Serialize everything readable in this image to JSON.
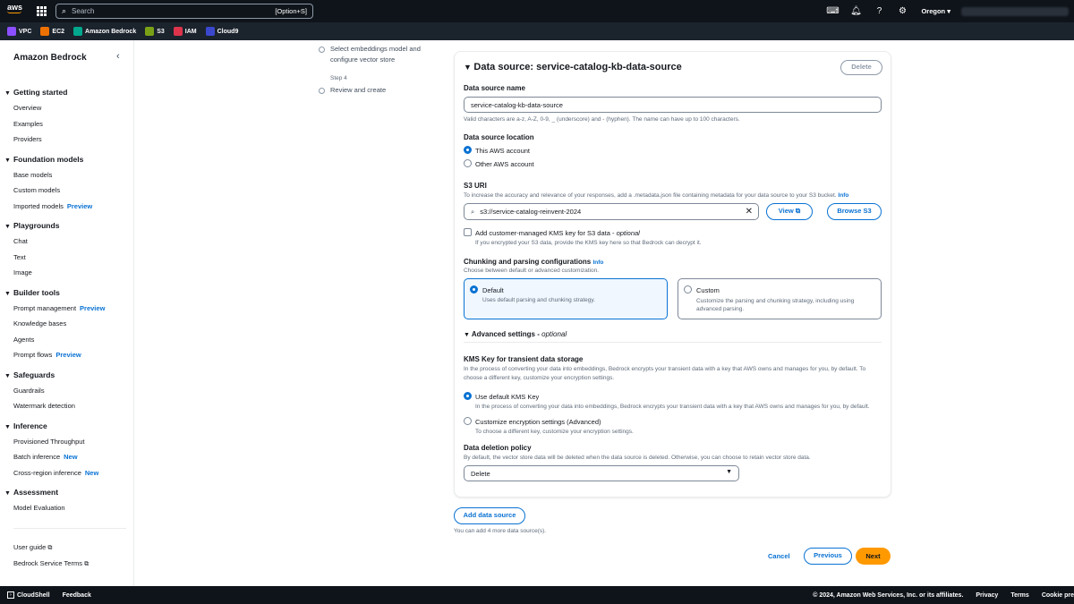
{
  "topbar": {
    "logo_text": "aws",
    "search_placeholder": "Search",
    "search_shortcut": "[Option+S]",
    "region": "Oregon"
  },
  "favorites": [
    {
      "label": "VPC",
      "color": "#8c4fff"
    },
    {
      "label": "EC2",
      "color": "#ed7100"
    },
    {
      "label": "Amazon Bedrock",
      "color": "#01a88d"
    },
    {
      "label": "S3",
      "color": "#7aa116"
    },
    {
      "label": "IAM",
      "color": "#dd344c"
    },
    {
      "label": "Cloud9",
      "color": "#3b48cc"
    }
  ],
  "sidebar": {
    "title": "Amazon Bedrock",
    "sections": [
      {
        "title": "Getting started",
        "items": [
          {
            "label": "Overview"
          },
          {
            "label": "Examples"
          },
          {
            "label": "Providers"
          }
        ]
      },
      {
        "title": "Foundation models",
        "items": [
          {
            "label": "Base models"
          },
          {
            "label": "Custom models"
          },
          {
            "label": "Imported models",
            "badge": "Preview"
          }
        ]
      },
      {
        "title": "Playgrounds",
        "items": [
          {
            "label": "Chat"
          },
          {
            "label": "Text"
          },
          {
            "label": "Image"
          }
        ]
      },
      {
        "title": "Builder tools",
        "items": [
          {
            "label": "Prompt management",
            "badge": "Preview"
          },
          {
            "label": "Knowledge bases"
          },
          {
            "label": "Agents"
          },
          {
            "label": "Prompt flows",
            "badge": "Preview"
          }
        ]
      },
      {
        "title": "Safeguards",
        "items": [
          {
            "label": "Guardrails"
          },
          {
            "label": "Watermark detection"
          }
        ]
      },
      {
        "title": "Inference",
        "items": [
          {
            "label": "Provisioned Throughput"
          },
          {
            "label": "Batch inference",
            "badge": "New"
          },
          {
            "label": "Cross-region inference",
            "badge": "New"
          }
        ]
      },
      {
        "title": "Assessment",
        "items": [
          {
            "label": "Model Evaluation"
          }
        ]
      }
    ],
    "footer_links": [
      {
        "label": "User guide"
      },
      {
        "label": "Bedrock Service Terms"
      }
    ]
  },
  "steps": {
    "step3_label": "Select embeddings model and configure vector store",
    "step4_num": "Step 4",
    "step4_label": "Review and create"
  },
  "panel": {
    "title": "Data source: service-catalog-kb-data-source",
    "delete_label": "Delete",
    "name_label": "Data source name",
    "name_value": "service-catalog-kb-data-source",
    "name_hint": "Valid characters are a-z, A-Z, 0-9, _ (underscore) and - (hyphen). The name can have up to 100 characters.",
    "location_label": "Data source location",
    "loc_this": "This AWS account",
    "loc_other": "Other AWS account",
    "s3_label": "S3 URI",
    "s3_hint": "To increase the accuracy and relevance of your responses, add a .metadata.json file containing metadata for your data source to your S3 bucket.",
    "info": "Info",
    "s3_value": "s3://service-catalog-reinvent-2024",
    "view_label": "View",
    "browse_label": "Browse S3",
    "kms_cb_label": "Add customer-managed KMS key for S3 data - ",
    "optional": "optional",
    "kms_cb_hint": "If you encrypted your S3 data, provide the KMS key here so that Bedrock can decrypt it.",
    "chunk_label": "Chunking and parsing configurations",
    "chunk_hint": "Choose between default or advanced customization.",
    "default_title": "Default",
    "default_desc": "Uses default parsing and chunking strategy.",
    "custom_title": "Custom",
    "custom_desc": "Customize the parsing and chunking strategy, including using advanced parsing.",
    "advanced_label": "Advanced settings - ",
    "kms_transient_label": "KMS Key for transient data storage",
    "kms_transient_hint": "In the process of converting your data into embeddings, Bedrock encrypts your transient data with a key that AWS owns and manages for you, by default. To choose a different key, customize your encryption settings.",
    "use_default_kms": "Use default KMS Key",
    "use_default_kms_hint": "In the process of converting your data into embeddings, Bedrock encrypts your transient data with a key that AWS owns and manages for you, by default.",
    "customize_enc": "Customize encryption settings (Advanced)",
    "customize_enc_hint": "To choose a different key, customize your encryption settings.",
    "deletion_label": "Data deletion policy",
    "deletion_hint": "By default, the vector store data will be deleted when the data source is deleted. Otherwise, you can choose to retain vector store data.",
    "deletion_value": "Delete"
  },
  "actions": {
    "add_ds": "Add data source",
    "add_ds_hint": "You can add 4 more data source(s).",
    "cancel": "Cancel",
    "previous": "Previous",
    "next": "Next"
  },
  "footer": {
    "cloudshell": "CloudShell",
    "feedback": "Feedback",
    "copyright": "© 2024, Amazon Web Services, Inc. or its affiliates.",
    "privacy": "Privacy",
    "terms": "Terms",
    "cookie": "Cookie pre"
  }
}
